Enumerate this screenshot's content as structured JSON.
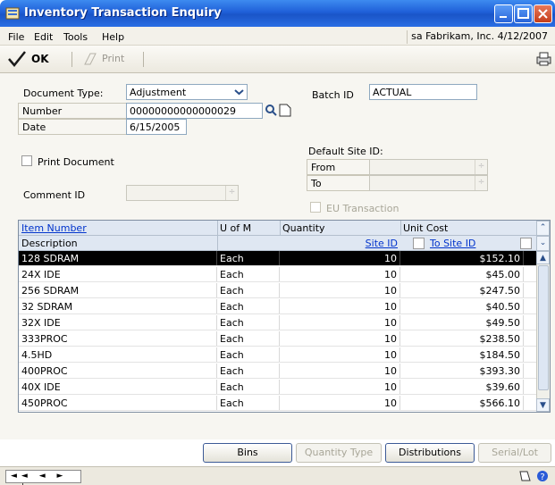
{
  "window": {
    "title": "Inventory Transaction Enquiry"
  },
  "menu": {
    "items": [
      "File",
      "Edit",
      "Tools",
      "Help"
    ],
    "user_info": "sa  Fabrikam, Inc.  4/12/2007"
  },
  "toolbar": {
    "ok_label": "OK",
    "print_label": "Print"
  },
  "form": {
    "document_type_label": "Document Type:",
    "document_type_value": "Adjustment",
    "number_label": "Number",
    "number_value": "00000000000000029",
    "date_label": "Date",
    "date_value": "6/15/2005",
    "batch_label": "Batch ID",
    "batch_value": "ACTUAL",
    "print_document_label": "Print Document",
    "default_site_label": "Default Site ID:",
    "from_label": "From",
    "to_label": "To",
    "comment_label": "Comment ID",
    "eu_label": "EU Transaction"
  },
  "grid": {
    "headers": {
      "item_number": "Item Number",
      "uom": "U of M",
      "quantity": "Quantity",
      "unit_cost": "Unit Cost",
      "description": "Description",
      "site_id": "Site ID",
      "to_site_id": "To Site ID"
    },
    "rows": [
      {
        "item": "128 SDRAM",
        "uom": "Each",
        "qty": "10",
        "cost": "$152.10"
      },
      {
        "item": "24X IDE",
        "uom": "Each",
        "qty": "10",
        "cost": "$45.00"
      },
      {
        "item": "256 SDRAM",
        "uom": "Each",
        "qty": "10",
        "cost": "$247.50"
      },
      {
        "item": "32 SDRAM",
        "uom": "Each",
        "qty": "10",
        "cost": "$40.50"
      },
      {
        "item": "32X IDE",
        "uom": "Each",
        "qty": "10",
        "cost": "$49.50"
      },
      {
        "item": "333PROC",
        "uom": "Each",
        "qty": "10",
        "cost": "$238.50"
      },
      {
        "item": "4.5HD",
        "uom": "Each",
        "qty": "10",
        "cost": "$184.50"
      },
      {
        "item": "400PROC",
        "uom": "Each",
        "qty": "10",
        "cost": "$393.30"
      },
      {
        "item": "40X IDE",
        "uom": "Each",
        "qty": "10",
        "cost": "$39.60"
      },
      {
        "item": "450PROC",
        "uom": "Each",
        "qty": "10",
        "cost": "$566.10"
      }
    ]
  },
  "buttons": {
    "bins": "Bins",
    "quantity_type": "Quantity Type",
    "distributions": "Distributions",
    "serial_lot": "Serial/Lot"
  },
  "status": {
    "nav": "◄◄ ◄ ► ►|"
  }
}
